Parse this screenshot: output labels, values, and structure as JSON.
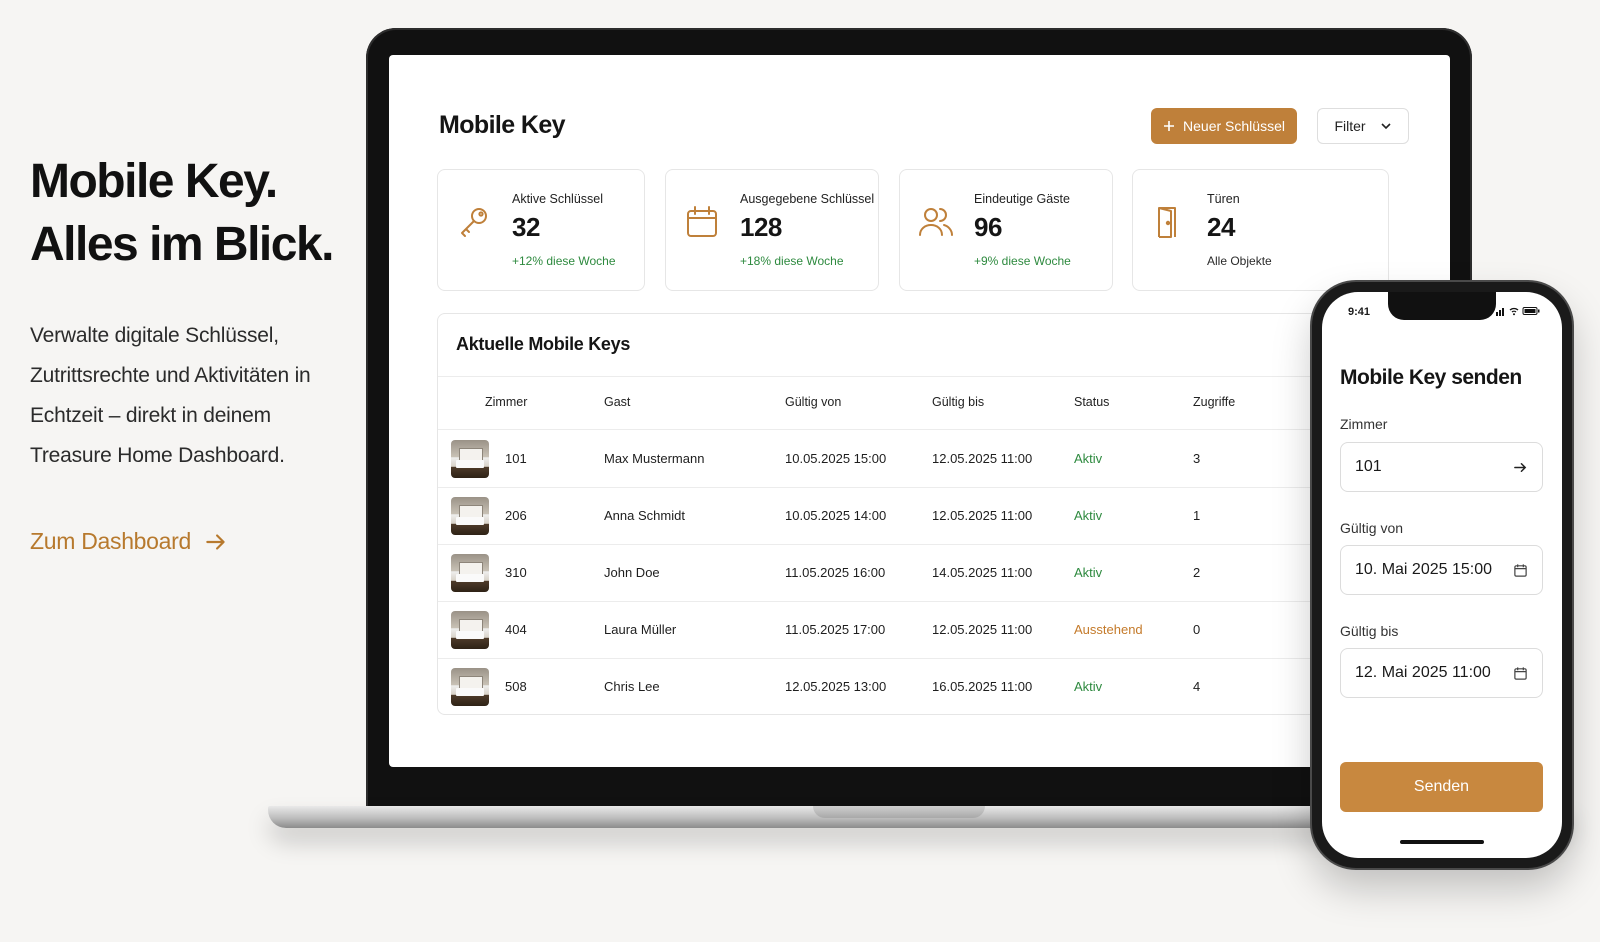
{
  "hero": {
    "headline_line1": "Mobile Key.",
    "headline_line2": "Alles im Blick.",
    "body": "Verwalte digitale Schlüssel, Zutrittsrechte und Aktivitäten in Echtzeit – direkt in deinem Treasure Home Dashboard.",
    "cta": "Zum Dashboard"
  },
  "dashboard": {
    "title": "Mobile Key",
    "new_key_button": "Neuer Schlüssel",
    "filter_button": "Filter",
    "stats": [
      {
        "icon": "key-icon",
        "label": "Aktive Schlüssel",
        "value": "32",
        "trend": "+12% diese Woche"
      },
      {
        "icon": "calendar-icon",
        "label": "Ausgegebene Schlüssel",
        "value": "128",
        "trend": "+18% diese Woche"
      },
      {
        "icon": "users-icon",
        "label": "Eindeutige Gäste",
        "value": "96",
        "trend": "+9% diese Woche"
      },
      {
        "icon": "door-icon",
        "label": "Türen",
        "value": "24",
        "trend": "Alle Objekte"
      }
    ],
    "table": {
      "title": "Aktuelle Mobile Keys",
      "columns": [
        "Zimmer",
        "Gast",
        "Gültig von",
        "Gültig bis",
        "Status",
        "Zugriffe"
      ],
      "rows": [
        {
          "room": "101",
          "guest": "Max Mustermann",
          "from": "10.05.2025 15:00",
          "to": "12.05.2025 11:00",
          "status": "Aktiv",
          "access": "3"
        },
        {
          "room": "206",
          "guest": "Anna Schmidt",
          "from": "10.05.2025 14:00",
          "to": "12.05.2025 11:00",
          "status": "Aktiv",
          "access": "1"
        },
        {
          "room": "310",
          "guest": "John Doe",
          "from": "11.05.2025 16:00",
          "to": "14.05.2025 11:00",
          "status": "Aktiv",
          "access": "2"
        },
        {
          "room": "404",
          "guest": "Laura Müller",
          "from": "11.05.2025 17:00",
          "to": "12.05.2025 11:00",
          "status": "Ausstehend",
          "access": "0"
        },
        {
          "room": "508",
          "guest": "Chris Lee",
          "from": "12.05.2025 13:00",
          "to": "16.05.2025 11:00",
          "status": "Aktiv",
          "access": "4"
        }
      ]
    }
  },
  "phone": {
    "time": "9:41",
    "title": "Mobile Key senden",
    "room_label": "Zimmer",
    "room_value": "101",
    "from_label": "Gültig von",
    "from_value": "10. Mai 2025 15:00",
    "to_label": "Gültig bis",
    "to_value": "12. Mai 2025 11:00",
    "send_button": "Senden"
  },
  "colors": {
    "accent": "#bf803a",
    "status_active": "#2e8a3f",
    "status_pending": "#c47a2a",
    "background": "#f6f5f3"
  }
}
